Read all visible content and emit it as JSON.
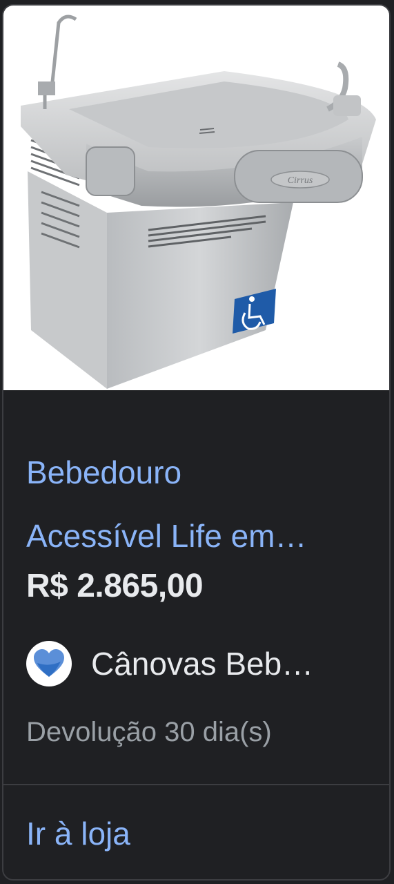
{
  "product": {
    "title_line1": "Bebedouro",
    "title_line2": "Acessível Life em…",
    "price": "R$ 2.865,00",
    "merchant_name": "Cânovas Beb…",
    "returns": "Devolução 30 dia(s)",
    "store_link": "Ir à loja",
    "image_logo_text": "Cirrus"
  },
  "colors": {
    "link": "#8ab4f8",
    "background": "#1f2023",
    "price": "#e8eaed",
    "muted": "#9aa0a6"
  }
}
